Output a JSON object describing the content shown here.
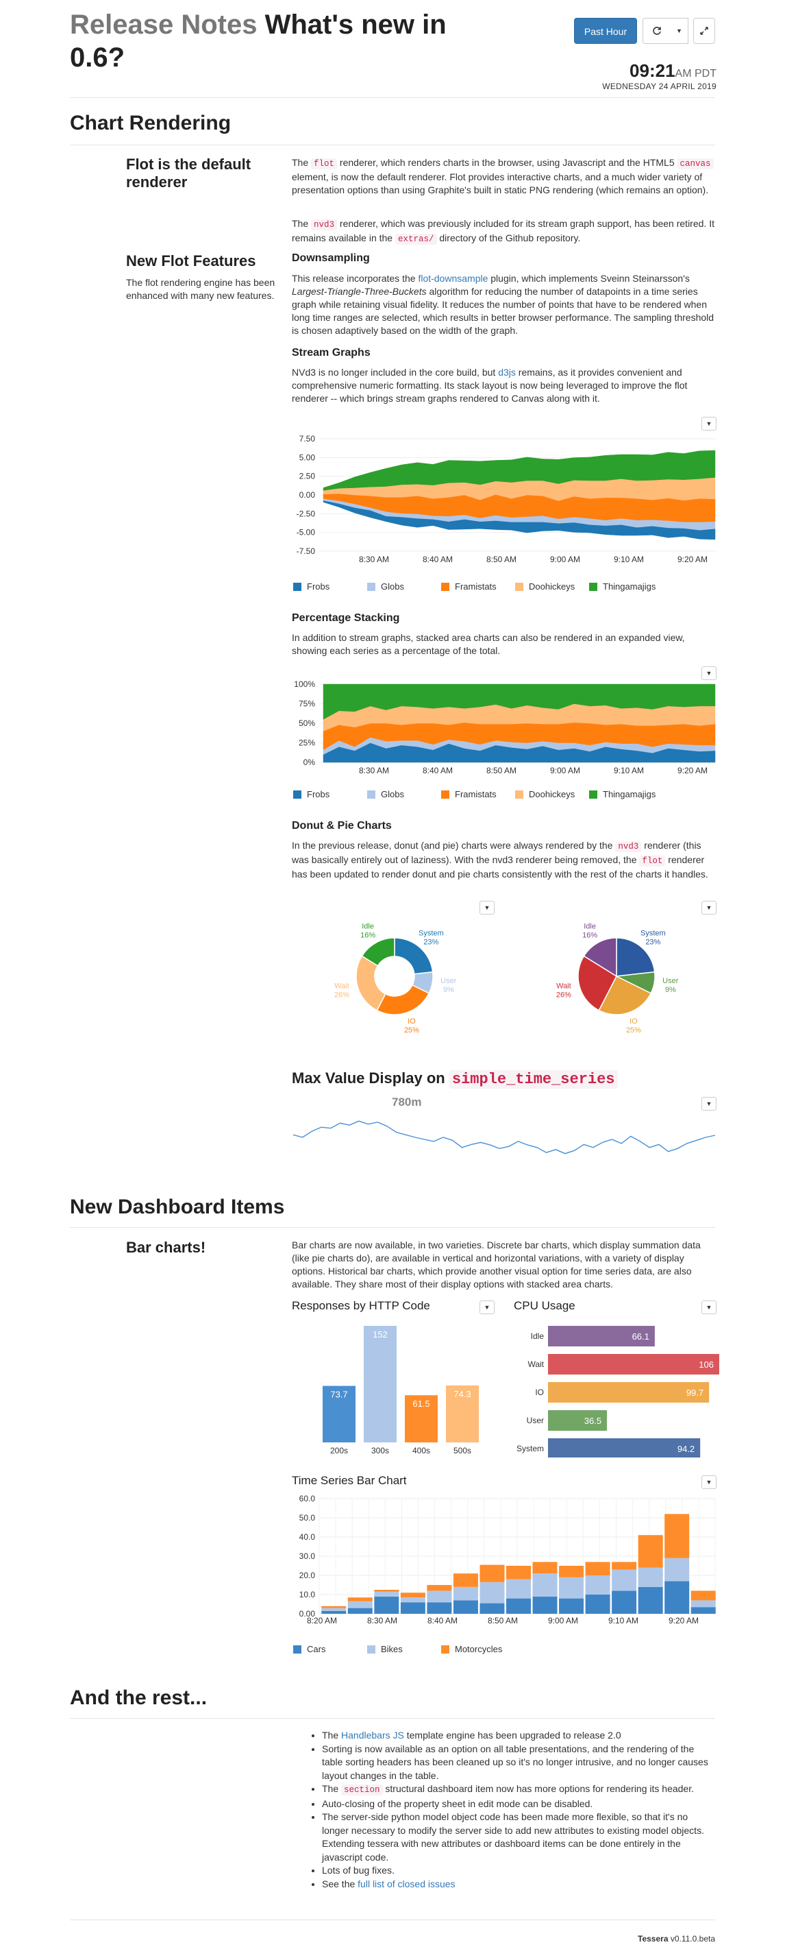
{
  "header": {
    "title_muted": "Release Notes",
    "title_main": "What's new in 0.6?",
    "past_hour_button": "Past Hour",
    "refresh_icon": "refresh-icon",
    "dropdown_icon": "caret-down-icon",
    "fullscreen_icon": "expand-icon",
    "clock_time": "09:21",
    "clock_ampm": "AM PDT",
    "clock_date": "WEDNESDAY 24 APRIL 2019"
  },
  "chart_rendering": {
    "title": "Chart Rendering",
    "flot_default_heading": "Flot is the default renderer",
    "flot_para_1a": "The ",
    "flot_code": "flot",
    "flot_para_1b": " renderer, which renders charts in the browser, using Javascript and the HTML5 ",
    "canvas_code": "canvas",
    "flot_para_1c": " element, is now the default renderer. Flot provides interactive charts, and a much wider variety of presentation options than using Graphite's built in static PNG rendering (which remains an option).",
    "nvd3_para_a": "The ",
    "nvd3_code": "nvd3",
    "nvd3_para_b": " renderer, which was previously included for its stream graph support, has been retired. It remains available in the ",
    "extras_code": "extras/",
    "nvd3_para_c": " directory of the Github repository.",
    "new_flot_heading": "New Flot Features",
    "new_flot_desc": "The flot rendering engine has been enhanced with many new features.",
    "downsampling_heading": "Downsampling",
    "downsampling_a": "This release incorporates the ",
    "downsampling_link": "flot-downsample",
    "downsampling_b": " plugin, which implements Sveinn Steinarsson's ",
    "downsampling_em": "Largest-Triangle-Three-Buckets",
    "downsampling_c": " algorithm for reducing the number of datapoints in a time series graph while retaining visual fidelity. It reduces the number of points that have to be rendered when long time ranges are selected, which results in better browser performance. The sampling threshold is chosen adaptively based on the width of the graph.",
    "stream_heading": "Stream Graphs",
    "stream_a": "NVd3 is no longer included in the core build, but ",
    "stream_link": "d3js",
    "stream_b": " remains, as it provides convenient and comprehensive numeric formatting. Its stack layout is now being leveraged to improve the flot renderer -- which brings stream graphs rendered to Canvas along with it.",
    "pct_heading": "Percentage Stacking",
    "pct_text": "In addition to stream graphs, stacked area charts can also be rendered in an expanded view, showing each series as a percentage of the total.",
    "donut_heading": "Donut & Pie Charts",
    "donut_a": "In the previous release, donut (and pie) charts were always rendered by the ",
    "donut_code1": "nvd3",
    "donut_b": " renderer (this was basically entirely out of laziness). With the nvd3 renderer being removed, the ",
    "donut_code2": "flot",
    "donut_c": " renderer has been updated to render donut and pie charts consistently with the rest of the charts it handles.",
    "maxval_heading": "Max Value Display on ",
    "maxval_code": "simple_time_series",
    "maxval_label": "780m"
  },
  "dashboard_items": {
    "title": "New Dashboard Items",
    "bar_heading": "Bar charts!",
    "bar_text": "Bar charts are now available, in two varieties. Discrete bar charts, which display summation data (like pie charts do), are available in vertical and horizontal variations, with a variety of display options. Historical bar charts, which provide another visual option for time series data, are also available. They share most of their display options with stacked area charts.",
    "http_title": "Responses by HTTP Code",
    "cpu_title": "CPU Usage",
    "tsbar_title": "Time Series Bar Chart"
  },
  "rest": {
    "title": "And the rest...",
    "item1_a": "The ",
    "item1_link": "Handlebars JS",
    "item1_b": " template engine has been upgraded to release 2.0",
    "item2": "Sorting is now available as an option on all table presentations, and the rendering of the table sorting headers has been cleaned up so it's no longer intrusive, and no longer causes layout changes in the table.",
    "item3_a": "The ",
    "item3_code": "section",
    "item3_b": " structural dashboard item now has more options for rendering its header.",
    "item4": "Auto-closing of the property sheet in edit mode can be disabled.",
    "item5": "The server-side python model object code has been made more flexible, so that it's no longer necessary to modify the server side to add new attributes to existing model objects. Extending tessera with new attributes or dashboard items can be done entirely in the javascript code.",
    "item6": "Lots of bug fixes.",
    "item7_a": "See the ",
    "item7_link": "full list of closed issues"
  },
  "footer": {
    "brand": "Tessera",
    "version": " v0.11.0.beta"
  },
  "colors": {
    "frobs": "#1f77b4",
    "globs": "#aec7e8",
    "framistats": "#ff7f0e",
    "doohickeys": "#ffbb78",
    "thingamajigs": "#2ca02c"
  },
  "chart_data": [
    {
      "id": "stream",
      "type": "area",
      "ylim": [
        -7.5,
        7.5
      ],
      "yticks": [
        "7.50",
        "5.00",
        "2.50",
        "0.00",
        "-2.50",
        "-5.00",
        "-7.50"
      ],
      "xticks": [
        "8:30 AM",
        "8:40 AM",
        "8:50 AM",
        "9:00 AM",
        "9:10 AM",
        "9:20 AM"
      ],
      "series": [
        {
          "name": "Frobs",
          "color": "#1f77b4",
          "values": [
            0.2,
            0.4,
            0.6,
            0.8,
            0.6,
            0.9,
            1.0,
            0.7,
            0.9,
            1.1,
            0.8,
            1.0,
            0.9,
            1.2,
            1.0,
            0.8,
            1.1,
            0.9,
            1.0,
            1.2,
            0.9,
            1.0,
            1.1,
            0.9,
            1.0,
            1.2
          ]
        },
        {
          "name": "Globs",
          "color": "#aec7e8",
          "values": [
            0.2,
            0.3,
            0.4,
            0.3,
            0.5,
            0.4,
            0.5,
            0.4,
            0.6,
            0.5,
            0.4,
            0.6,
            0.5,
            0.6,
            0.7,
            0.5,
            0.6,
            0.7,
            0.6,
            0.7,
            0.8,
            0.7,
            0.8,
            0.7,
            0.9,
            0.8
          ]
        },
        {
          "name": "Framistats",
          "color": "#ff7f0e",
          "values": [
            0.5,
            0.8,
            1.0,
            1.3,
            1.6,
            1.8,
            2.0,
            1.9,
            2.1,
            2.2,
            2.0,
            2.3,
            2.1,
            2.4,
            2.2,
            2.0,
            2.3,
            2.2,
            2.5,
            2.3,
            2.4,
            2.2,
            2.5,
            2.4,
            2.6,
            2.5
          ]
        },
        {
          "name": "Doohickeys",
          "color": "#ffbb78",
          "values": [
            0.4,
            0.6,
            0.8,
            1.0,
            1.2,
            1.4,
            1.3,
            1.5,
            1.6,
            1.4,
            1.7,
            1.5,
            1.8,
            1.6,
            1.7,
            1.9,
            1.8,
            2.0,
            1.9,
            2.1,
            2.0,
            2.2,
            2.1,
            2.3,
            2.2,
            2.4
          ]
        },
        {
          "name": "Thingamajigs",
          "color": "#2ca02c",
          "values": [
            0.3,
            0.6,
            1.2,
            1.6,
            2.0,
            2.2,
            2.4,
            2.3,
            2.5,
            2.4,
            2.6,
            2.3,
            2.5,
            2.6,
            2.4,
            2.7,
            2.5,
            2.6,
            2.8,
            2.7,
            2.9,
            2.8,
            3.0,
            2.9,
            3.1,
            3.0
          ]
        }
      ]
    },
    {
      "id": "percent",
      "type": "area",
      "ylim": [
        0,
        100
      ],
      "yticks": [
        "100%",
        "75%",
        "50%",
        "25%",
        "0%"
      ],
      "xticks": [
        "8:30 AM",
        "8:40 AM",
        "8:50 AM",
        "9:00 AM",
        "9:10 AM",
        "9:20 AM"
      ],
      "series": [
        {
          "name": "Frobs",
          "color": "#1f77b4",
          "values": [
            10,
            20,
            15,
            25,
            18,
            22,
            20,
            16,
            24,
            18,
            15,
            22,
            19,
            17,
            21,
            16,
            18,
            14,
            20,
            17,
            15,
            12,
            18,
            16,
            14,
            15
          ]
        },
        {
          "name": "Globs",
          "color": "#aec7e8",
          "values": [
            6,
            8,
            5,
            7,
            9,
            6,
            8,
            7,
            5,
            9,
            8,
            6,
            7,
            8,
            6,
            9,
            7,
            8,
            6,
            7,
            9,
            8,
            6,
            7,
            8,
            7
          ]
        },
        {
          "name": "Framistats",
          "color": "#ff7f0e",
          "values": [
            24,
            20,
            25,
            18,
            23,
            20,
            22,
            27,
            19,
            24,
            26,
            21,
            23,
            25,
            22,
            24,
            26,
            28,
            22,
            25,
            23,
            27,
            24,
            26,
            25,
            27
          ]
        },
        {
          "name": "Doohickeys",
          "color": "#ffbb78",
          "values": [
            15,
            18,
            20,
            22,
            17,
            24,
            21,
            19,
            23,
            18,
            22,
            25,
            20,
            23,
            21,
            19,
            24,
            22,
            25,
            20,
            23,
            21,
            24,
            22,
            25,
            23
          ]
        },
        {
          "name": "Thingamajigs",
          "color": "#2ca02c",
          "values": [
            45,
            34,
            35,
            28,
            33,
            28,
            29,
            31,
            29,
            31,
            29,
            26,
            31,
            27,
            30,
            32,
            25,
            28,
            27,
            31,
            30,
            32,
            28,
            29,
            28,
            28
          ]
        }
      ]
    },
    {
      "id": "donut",
      "type": "pie",
      "hole": true,
      "slices": [
        {
          "label": "System",
          "value": 23,
          "pct": "23%",
          "color": "#1f77b4"
        },
        {
          "label": "User",
          "value": 9,
          "pct": "9%",
          "color": "#aec7e8"
        },
        {
          "label": "IO",
          "value": 25,
          "pct": "25%",
          "color": "#ff7f0e"
        },
        {
          "label": "Wait",
          "value": 26,
          "pct": "26%",
          "color": "#ffbb78"
        },
        {
          "label": "Idle",
          "value": 16,
          "pct": "16%",
          "color": "#2ca02c"
        }
      ]
    },
    {
      "id": "pie",
      "type": "pie",
      "hole": false,
      "slices": [
        {
          "label": "System",
          "value": 23,
          "pct": "23%",
          "color": "#2c5aa0"
        },
        {
          "label": "User",
          "value": 9,
          "pct": "9%",
          "color": "#5a9a48"
        },
        {
          "label": "IO",
          "value": 25,
          "pct": "25%",
          "color": "#e8a33d"
        },
        {
          "label": "Wait",
          "value": 26,
          "pct": "26%",
          "color": "#cd3134"
        },
        {
          "label": "Idle",
          "value": 16,
          "pct": "16%",
          "color": "#7b4b8f"
        }
      ]
    },
    {
      "id": "sparkline",
      "type": "line",
      "label": "780m",
      "values": [
        0.55,
        0.5,
        0.62,
        0.7,
        0.68,
        0.78,
        0.74,
        0.82,
        0.76,
        0.8,
        0.72,
        0.6,
        0.55,
        0.5,
        0.46,
        0.42,
        0.5,
        0.44,
        0.3,
        0.36,
        0.4,
        0.35,
        0.28,
        0.32,
        0.42,
        0.35,
        0.3,
        0.2,
        0.26,
        0.18,
        0.24,
        0.36,
        0.3,
        0.4,
        0.46,
        0.38,
        0.52,
        0.42,
        0.3,
        0.36,
        0.22,
        0.28,
        0.38,
        0.44,
        0.5,
        0.54
      ]
    },
    {
      "id": "http",
      "type": "bar",
      "categories": [
        "200s",
        "300s",
        "400s",
        "500s"
      ],
      "values": [
        73.7,
        152,
        61.5,
        74.3
      ],
      "labels": [
        "73.7",
        "152",
        "61.5",
        "74.3"
      ],
      "colors": [
        "#4a8fd0",
        "#aec7e8",
        "#ff8c2a",
        "#ffbb78"
      ],
      "ylim": [
        0,
        152
      ]
    },
    {
      "id": "cpu",
      "type": "bar",
      "orientation": "horizontal",
      "categories": [
        "Idle",
        "Wait",
        "IO",
        "User",
        "System"
      ],
      "values": [
        66.1,
        106,
        99.7,
        36.5,
        94.2
      ],
      "labels": [
        "66.1",
        "106",
        "99.7",
        "36.5",
        "94.2"
      ],
      "colors": [
        "#8a6a9c",
        "#d9575c",
        "#f0ab4f",
        "#72a665",
        "#4f72a8"
      ],
      "xlim": [
        0,
        106
      ]
    },
    {
      "id": "tsbar",
      "type": "bar",
      "stacked": true,
      "ylim": [
        0,
        60
      ],
      "yticks": [
        "60.0",
        "50.0",
        "40.0",
        "30.0",
        "20.0",
        "10.0",
        "0.00"
      ],
      "xticks": [
        "8:20 AM",
        "8:30 AM",
        "8:40 AM",
        "8:50 AM",
        "9:00 AM",
        "9:10 AM",
        "9:20 AM"
      ],
      "series": [
        {
          "name": "Cars",
          "color": "#3d84c6",
          "values": [
            1.5,
            3.0,
            9.0,
            6.0,
            6.0,
            7.0,
            5.5,
            8.0,
            9.0,
            8.0,
            10.0,
            12.0,
            14.0,
            17.0,
            3.5
          ]
        },
        {
          "name": "Bikes",
          "color": "#aec7e8",
          "values": [
            1.5,
            3.5,
            2.5,
            2.5,
            6.0,
            7.0,
            11.0,
            10.0,
            12.0,
            11.0,
            10.0,
            11.0,
            10.0,
            12.0,
            3.5
          ]
        },
        {
          "name": "Motorcycles",
          "color": "#ff8c2a",
          "values": [
            1.0,
            2.0,
            1.0,
            2.5,
            3.0,
            7.0,
            9.0,
            7.0,
            6.0,
            6.0,
            7.0,
            4.0,
            17.0,
            23.0,
            5.0
          ]
        }
      ]
    }
  ]
}
